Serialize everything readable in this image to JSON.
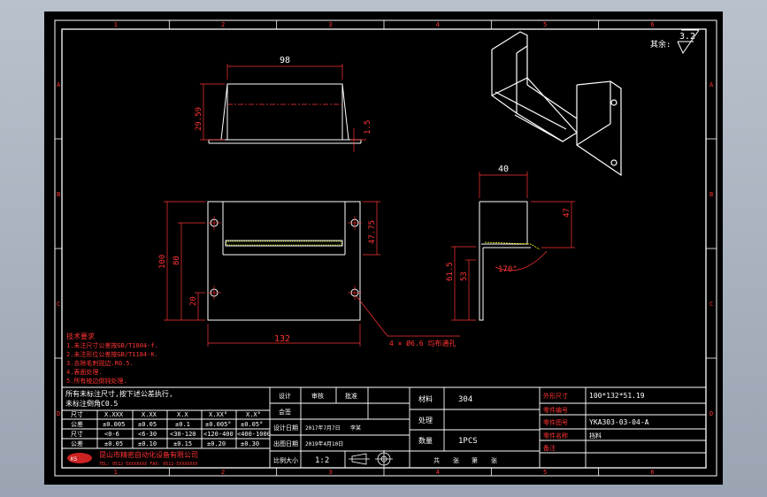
{
  "colors": {
    "background": "#000000",
    "frame": "#ffffff",
    "dimension": "#ff3333",
    "centerline": "#ff3333",
    "annotation": "#ff3333",
    "table_text": "#ffffff",
    "hidden": "#ffff00"
  },
  "border": {
    "col_labels": [
      "1",
      "2",
      "3",
      "4",
      "5",
      "6"
    ],
    "row_labels": [
      "A",
      "B",
      "C",
      "D"
    ]
  },
  "roughness": {
    "label": "其余:",
    "value": "3.2"
  },
  "dims": {
    "top_width": "98",
    "top_height": "29.59",
    "top_thickness": "1.5",
    "front_height_outer": "100",
    "front_height_inner": "80",
    "front_hole_offset": "20",
    "front_right": "47.75",
    "front_width": "132",
    "hole_callout": "4 × Ø6.6 均布通孔",
    "side_width": "40",
    "side_height_top": "47",
    "side_height_outer": "61.5",
    "side_height_inner": "53",
    "side_angle": "170°"
  },
  "notes": {
    "title": "技术要求",
    "lines": [
      "1.未注尺寸公差按GB/T1804-f.",
      "2.未注形位公差按GB/T1184-K.",
      "3.去除毛刺锐边.R0.5.",
      "4.表面处理.",
      "5.所有棱边倒钝处理."
    ]
  },
  "tolerance": {
    "header_note": "所有未标注尺寸,按下述公差执行,",
    "header_note2": "未标注倒角C0.5",
    "columns": [
      "尺寸",
      "X.XXX",
      "X.XX",
      "X.X",
      "X.XX°",
      "X.X°"
    ],
    "rows": [
      [
        "公差",
        "±0.005",
        "±0.05",
        "±0.1",
        "±0.005°",
        "±0.05°"
      ],
      [
        "尺寸",
        "<0-6",
        "<6-30",
        "<30-120",
        "<120-400",
        "<400-1000"
      ],
      [
        "公差",
        "±0.05",
        "±0.10",
        "±0.15",
        "±0.20",
        "±0.30"
      ]
    ],
    "company": "昆山市精密自动化设备有限公司",
    "company_sub": "TEL: 0512-5XXXXXXX  FAX: 0512-5XXXXXXX"
  },
  "sign": {
    "row1": [
      "设计",
      "审核",
      "批准"
    ],
    "row2_label": "会签",
    "row3_label": "设计日期",
    "row3_value": "2017年7月7日",
    "row3_extra": "李某",
    "row4_label": "出图日期",
    "row4_value": "2019年4月10日",
    "row5_label": "比例大小",
    "row5_value": "1:2"
  },
  "material": {
    "label1": "材料",
    "value1": "304",
    "label2": "处理",
    "value2": "",
    "label3": "数量",
    "value3": "1PCS",
    "footer": [
      "共",
      "张",
      "第",
      "张"
    ]
  },
  "title_block": {
    "labels": [
      "外形尺寸",
      "零件编号",
      "零件图号",
      "零件名称",
      "备注"
    ],
    "values": [
      "100*132*51.19",
      "",
      "YKA303-03-04-A",
      "挡料",
      ""
    ]
  }
}
